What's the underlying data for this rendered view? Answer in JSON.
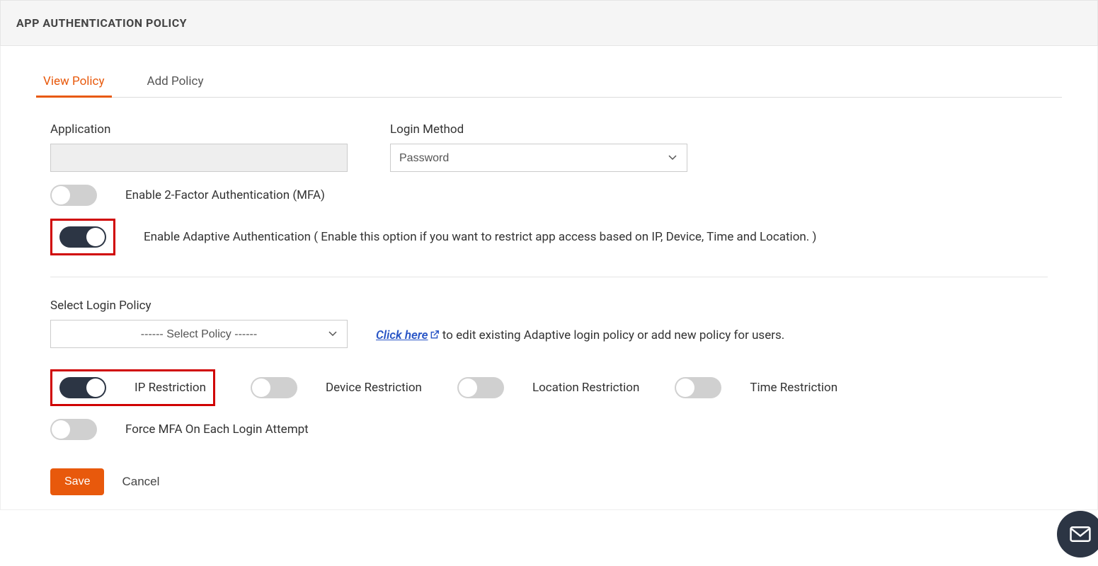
{
  "header": {
    "title": "APP AUTHENTICATION POLICY"
  },
  "tabs": {
    "view": "View Policy",
    "add": "Add Policy"
  },
  "labels": {
    "application": "Application",
    "login_method": "Login Method",
    "mfa": "Enable 2-Factor Authentication (MFA)",
    "adaptive": "Enable Adaptive Authentication ( Enable this option if you want to restrict app access based on IP, Device, Time and Location. )",
    "select_policy": "Select Login Policy",
    "policy_placeholder": "------ Select Policy ------",
    "click_here": "Click here",
    "helper_rest": " to edit existing Adaptive login policy or add new policy for users.",
    "ip": "IP Restriction",
    "device": "Device Restriction",
    "location": "Location Restriction",
    "time": "Time Restriction",
    "force_mfa": "Force MFA On Each Login Attempt"
  },
  "login_method_value": "Password",
  "buttons": {
    "save": "Save",
    "cancel": "Cancel"
  }
}
